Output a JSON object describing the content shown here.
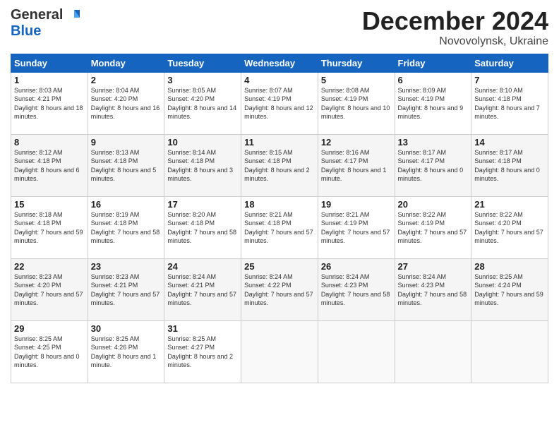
{
  "logo": {
    "general": "General",
    "blue": "Blue"
  },
  "title": "December 2024",
  "subtitle": "Novovolynsk, Ukraine",
  "days_of_week": [
    "Sunday",
    "Monday",
    "Tuesday",
    "Wednesday",
    "Thursday",
    "Friday",
    "Saturday"
  ],
  "weeks": [
    [
      {
        "day": "1",
        "sunrise": "8:03 AM",
        "sunset": "4:21 PM",
        "daylight": "8 hours and 18 minutes."
      },
      {
        "day": "2",
        "sunrise": "8:04 AM",
        "sunset": "4:20 PM",
        "daylight": "8 hours and 16 minutes."
      },
      {
        "day": "3",
        "sunrise": "8:05 AM",
        "sunset": "4:20 PM",
        "daylight": "8 hours and 14 minutes."
      },
      {
        "day": "4",
        "sunrise": "8:07 AM",
        "sunset": "4:19 PM",
        "daylight": "8 hours and 12 minutes."
      },
      {
        "day": "5",
        "sunrise": "8:08 AM",
        "sunset": "4:19 PM",
        "daylight": "8 hours and 10 minutes."
      },
      {
        "day": "6",
        "sunrise": "8:09 AM",
        "sunset": "4:19 PM",
        "daylight": "8 hours and 9 minutes."
      },
      {
        "day": "7",
        "sunrise": "8:10 AM",
        "sunset": "4:18 PM",
        "daylight": "8 hours and 7 minutes."
      }
    ],
    [
      {
        "day": "8",
        "sunrise": "8:12 AM",
        "sunset": "4:18 PM",
        "daylight": "8 hours and 6 minutes."
      },
      {
        "day": "9",
        "sunrise": "8:13 AM",
        "sunset": "4:18 PM",
        "daylight": "8 hours and 5 minutes."
      },
      {
        "day": "10",
        "sunrise": "8:14 AM",
        "sunset": "4:18 PM",
        "daylight": "8 hours and 3 minutes."
      },
      {
        "day": "11",
        "sunrise": "8:15 AM",
        "sunset": "4:18 PM",
        "daylight": "8 hours and 2 minutes."
      },
      {
        "day": "12",
        "sunrise": "8:16 AM",
        "sunset": "4:17 PM",
        "daylight": "8 hours and 1 minute."
      },
      {
        "day": "13",
        "sunrise": "8:17 AM",
        "sunset": "4:17 PM",
        "daylight": "8 hours and 0 minutes."
      },
      {
        "day": "14",
        "sunrise": "8:17 AM",
        "sunset": "4:18 PM",
        "daylight": "8 hours and 0 minutes."
      }
    ],
    [
      {
        "day": "15",
        "sunrise": "8:18 AM",
        "sunset": "4:18 PM",
        "daylight": "7 hours and 59 minutes."
      },
      {
        "day": "16",
        "sunrise": "8:19 AM",
        "sunset": "4:18 PM",
        "daylight": "7 hours and 58 minutes."
      },
      {
        "day": "17",
        "sunrise": "8:20 AM",
        "sunset": "4:18 PM",
        "daylight": "7 hours and 58 minutes."
      },
      {
        "day": "18",
        "sunrise": "8:21 AM",
        "sunset": "4:18 PM",
        "daylight": "7 hours and 57 minutes."
      },
      {
        "day": "19",
        "sunrise": "8:21 AM",
        "sunset": "4:19 PM",
        "daylight": "7 hours and 57 minutes."
      },
      {
        "day": "20",
        "sunrise": "8:22 AM",
        "sunset": "4:19 PM",
        "daylight": "7 hours and 57 minutes."
      },
      {
        "day": "21",
        "sunrise": "8:22 AM",
        "sunset": "4:20 PM",
        "daylight": "7 hours and 57 minutes."
      }
    ],
    [
      {
        "day": "22",
        "sunrise": "8:23 AM",
        "sunset": "4:20 PM",
        "daylight": "7 hours and 57 minutes."
      },
      {
        "day": "23",
        "sunrise": "8:23 AM",
        "sunset": "4:21 PM",
        "daylight": "7 hours and 57 minutes."
      },
      {
        "day": "24",
        "sunrise": "8:24 AM",
        "sunset": "4:21 PM",
        "daylight": "7 hours and 57 minutes."
      },
      {
        "day": "25",
        "sunrise": "8:24 AM",
        "sunset": "4:22 PM",
        "daylight": "7 hours and 57 minutes."
      },
      {
        "day": "26",
        "sunrise": "8:24 AM",
        "sunset": "4:23 PM",
        "daylight": "7 hours and 58 minutes."
      },
      {
        "day": "27",
        "sunrise": "8:24 AM",
        "sunset": "4:23 PM",
        "daylight": "7 hours and 58 minutes."
      },
      {
        "day": "28",
        "sunrise": "8:25 AM",
        "sunset": "4:24 PM",
        "daylight": "7 hours and 59 minutes."
      }
    ],
    [
      {
        "day": "29",
        "sunrise": "8:25 AM",
        "sunset": "4:25 PM",
        "daylight": "8 hours and 0 minutes."
      },
      {
        "day": "30",
        "sunrise": "8:25 AM",
        "sunset": "4:26 PM",
        "daylight": "8 hours and 1 minute."
      },
      {
        "day": "31",
        "sunrise": "8:25 AM",
        "sunset": "4:27 PM",
        "daylight": "8 hours and 2 minutes."
      },
      null,
      null,
      null,
      null
    ]
  ]
}
